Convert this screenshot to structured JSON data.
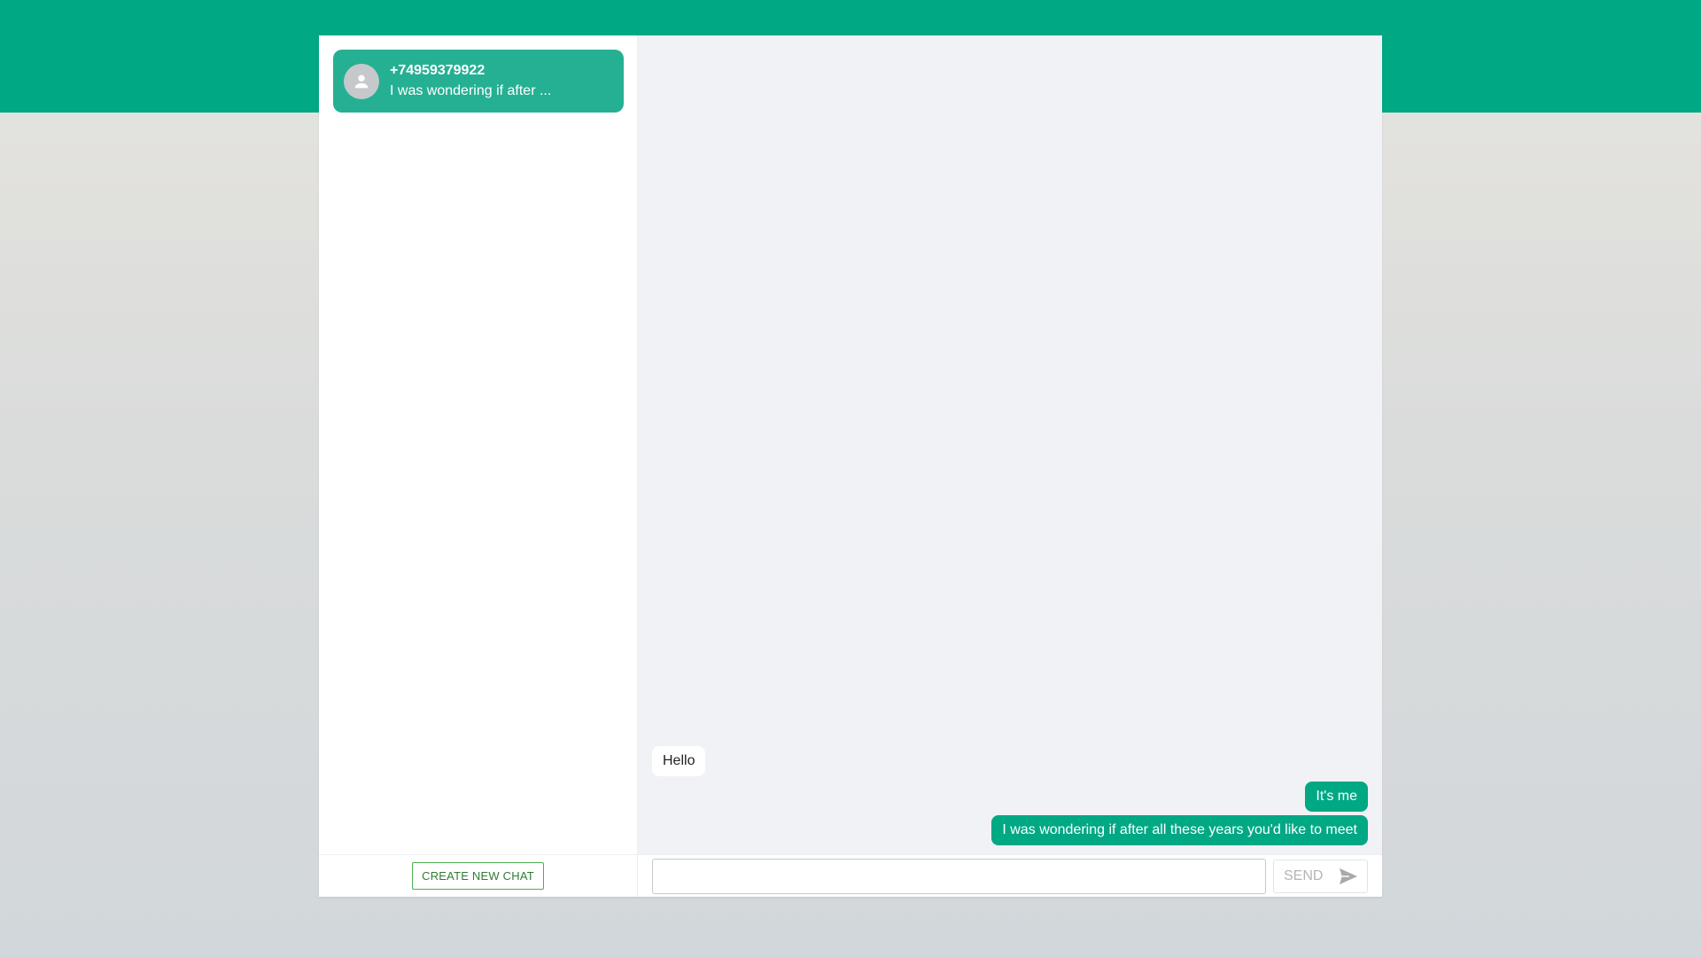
{
  "theme": {
    "accent": "#00a884",
    "chat_item_bg": "#25b093",
    "conversation_bg": "#f0f2f5"
  },
  "sidebar": {
    "chats": [
      {
        "name": "+74959379922",
        "preview": "I was wondering if after ...",
        "selected": true,
        "avatar_icon": "person-icon"
      }
    ],
    "new_chat_label": "CREATE NEW CHAT"
  },
  "conversation": {
    "messages": [
      {
        "direction": "incoming",
        "text": "Hello"
      },
      {
        "direction": "outgoing",
        "text": "It's me"
      },
      {
        "direction": "outgoing",
        "text": "I was wondering if after all these years you'd like to meet"
      }
    ]
  },
  "composer": {
    "input_value": "",
    "input_placeholder": "",
    "send_label": "SEND",
    "send_icon": "send-icon"
  }
}
